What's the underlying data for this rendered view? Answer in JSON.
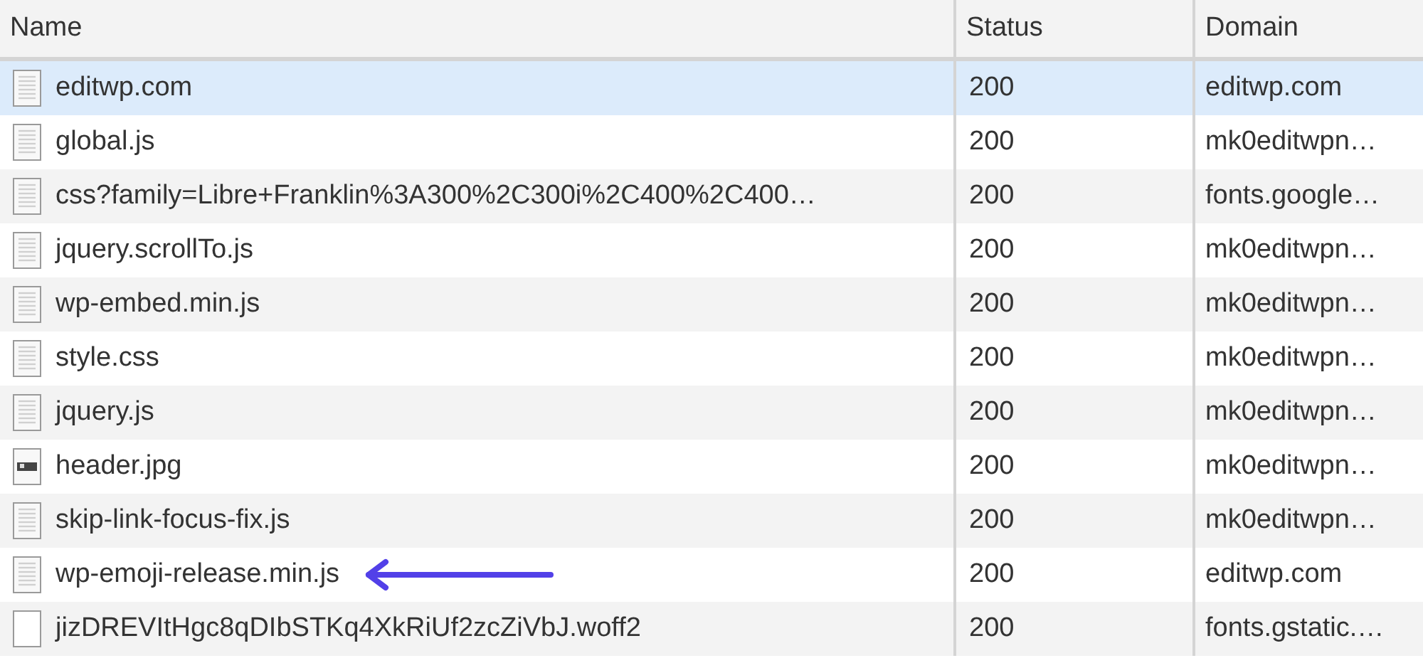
{
  "table": {
    "columns": [
      "Name",
      "Status",
      "Domain"
    ],
    "rows": [
      {
        "name": "editwp.com",
        "status": "200",
        "domain": "editwp.com",
        "kind": "document",
        "selected": true,
        "arrow": false
      },
      {
        "name": "global.js",
        "status": "200",
        "domain": "mk0editwpn…",
        "kind": "document",
        "selected": false,
        "arrow": false
      },
      {
        "name": "css?family=Libre+Franklin%3A300%2C300i%2C400%2C400…",
        "status": "200",
        "domain": "fonts.google…",
        "kind": "document",
        "selected": false,
        "arrow": false
      },
      {
        "name": "jquery.scrollTo.js",
        "status": "200",
        "domain": "mk0editwpn…",
        "kind": "document",
        "selected": false,
        "arrow": false
      },
      {
        "name": "wp-embed.min.js",
        "status": "200",
        "domain": "mk0editwpn…",
        "kind": "document",
        "selected": false,
        "arrow": false
      },
      {
        "name": "style.css",
        "status": "200",
        "domain": "mk0editwpn…",
        "kind": "document",
        "selected": false,
        "arrow": false
      },
      {
        "name": "jquery.js",
        "status": "200",
        "domain": "mk0editwpn…",
        "kind": "document",
        "selected": false,
        "arrow": false
      },
      {
        "name": "header.jpg",
        "status": "200",
        "domain": "mk0editwpn…",
        "kind": "image",
        "selected": false,
        "arrow": false
      },
      {
        "name": "skip-link-focus-fix.js",
        "status": "200",
        "domain": "mk0editwpn…",
        "kind": "document",
        "selected": false,
        "arrow": false
      },
      {
        "name": "wp-emoji-release.min.js",
        "status": "200",
        "domain": "editwp.com",
        "kind": "document",
        "selected": false,
        "arrow": true
      },
      {
        "name": "jizDREVItHgc8qDIbSTKq4XkRiUf2zcZiVbJ.woff2",
        "status": "200",
        "domain": "fonts.gstatic.…",
        "kind": "blank",
        "selected": false,
        "arrow": false
      }
    ]
  }
}
